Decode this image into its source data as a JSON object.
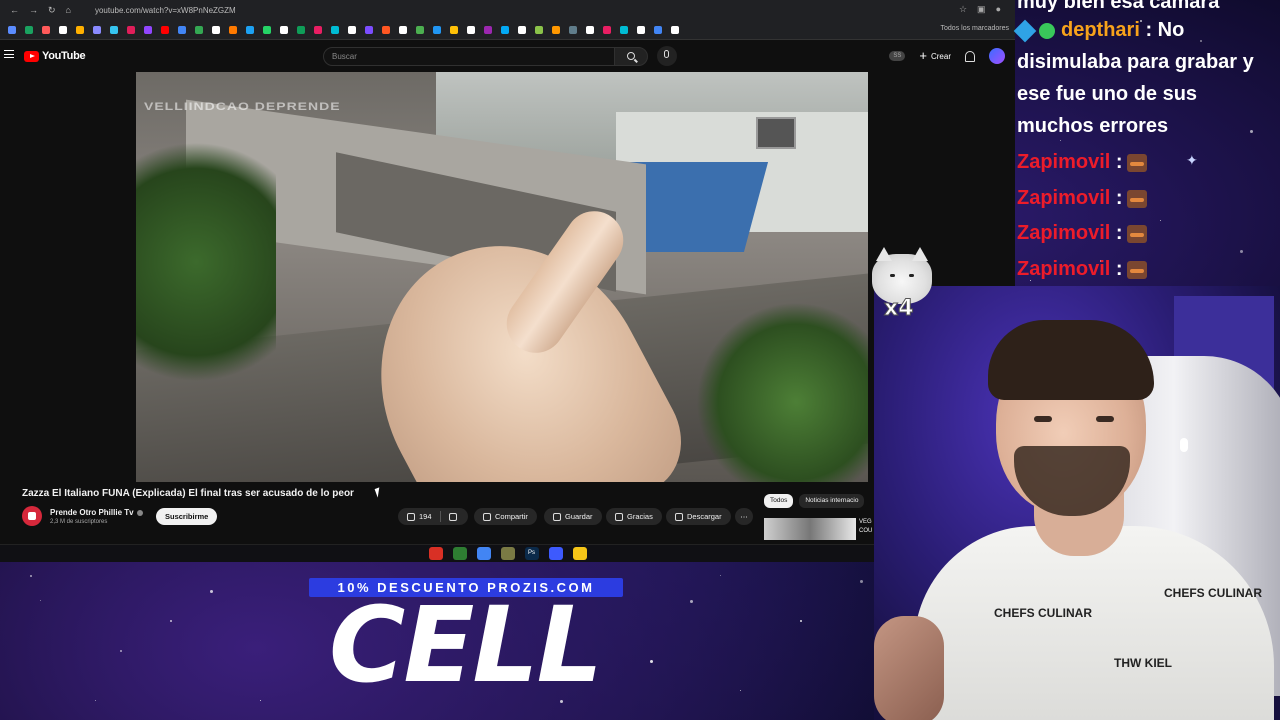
{
  "browser": {
    "url": "youtube.com/watch?v=xW8PnNeZGZM",
    "bookmarks_folder": "Todos los marcadores",
    "bookmark_colors": [
      "#5b8cff",
      "#1aa260",
      "#ff5a5a",
      "#ffffff",
      "#ffb000",
      "#8a8aff",
      "#36c5f0",
      "#e01e5a",
      "#9146ff",
      "#ff0000",
      "#4285f4",
      "#34a853",
      "#ffffff",
      "#ff7a00",
      "#1da1f2",
      "#25d366",
      "#ffffff",
      "#0f9d58",
      "#e91e63",
      "#00bcd4",
      "#ffffff",
      "#7c4dff",
      "#ff5722",
      "#ffffff",
      "#4caf50",
      "#2196f3",
      "#ffc107",
      "#ffffff",
      "#9c27b0",
      "#03a9f4",
      "#ffffff",
      "#8bc34a",
      "#ff9800",
      "#607d8b",
      "#ffffff",
      "#e91e63",
      "#00bcd4",
      "#ffffff",
      "#4285f4",
      "#ffffff"
    ]
  },
  "youtube": {
    "logo_text": "YouTube",
    "search_placeholder": "Buscar",
    "ss_badge": "SS",
    "create_label": "Crear",
    "video_watermark": "VELLIINDCAO DEPRENDE",
    "video_title": "Zazza El Italiano FUNA (Explicada) El final tras ser acusado de lo peor",
    "channel_name": "Prende Otro Phillie Tv",
    "subscribers": "2,3 M de suscriptores",
    "subscribe_label": "Suscribirme",
    "likes": "194",
    "share_label": "Compartir",
    "save_label": "Guardar",
    "thanks_label": "Gracias",
    "download_label": "Descargar",
    "chips": [
      "Todos",
      "Noticias internacio"
    ],
    "rec_text_line1": "VEG",
    "rec_text_line2": "COU"
  },
  "taskbar": {
    "items": [
      {
        "icon": "app-red-icon",
        "label": "",
        "color": "#d93025"
      },
      {
        "icon": "app-green-icon",
        "label": "",
        "color": "#2e7d32"
      },
      {
        "icon": "chrome-icon",
        "label": "",
        "color": "#4285f4"
      },
      {
        "icon": "app-tool-icon",
        "label": "",
        "color": "#7a7a44"
      },
      {
        "icon": "photoshop-icon",
        "label": "Ps",
        "color": "#0b2a4a"
      },
      {
        "icon": "app-globe-icon",
        "label": "",
        "color": "#3d5afe"
      },
      {
        "icon": "folder-icon",
        "label": "",
        "color": "#f5c518"
      }
    ]
  },
  "chat": {
    "partial_top": "muy bien esa cámara",
    "messages": [
      {
        "user": "depthari",
        "text": " : No",
        "style": "orange",
        "badges": true
      },
      {
        "user": "",
        "text": "disimulaba para grabar y",
        "style": "plain"
      },
      {
        "user": "",
        "text": "ese fue uno de sus",
        "style": "plain"
      },
      {
        "user": "",
        "text": "muchos errores",
        "style": "plain"
      },
      {
        "user": "Zapimovil",
        "text": " :",
        "style": "red",
        "emote": true
      },
      {
        "user": "Zapimovil",
        "text": " :",
        "style": "red",
        "emote": true
      },
      {
        "user": "Zapimovil",
        "text": " :",
        "style": "red",
        "emote": true
      },
      {
        "user": "Zapimovil",
        "text": " :",
        "style": "red",
        "emote": true
      }
    ]
  },
  "overlay": {
    "cat_multiplier": "x4",
    "promo_bar": "10% DESCUENTO PROZIS.COM",
    "promo_code": "CELL",
    "shirt_text_1": "CHEFS CULINAR",
    "shirt_text_2": "CHEFS CULINAR",
    "shirt_text_3": "THW KIEL"
  }
}
